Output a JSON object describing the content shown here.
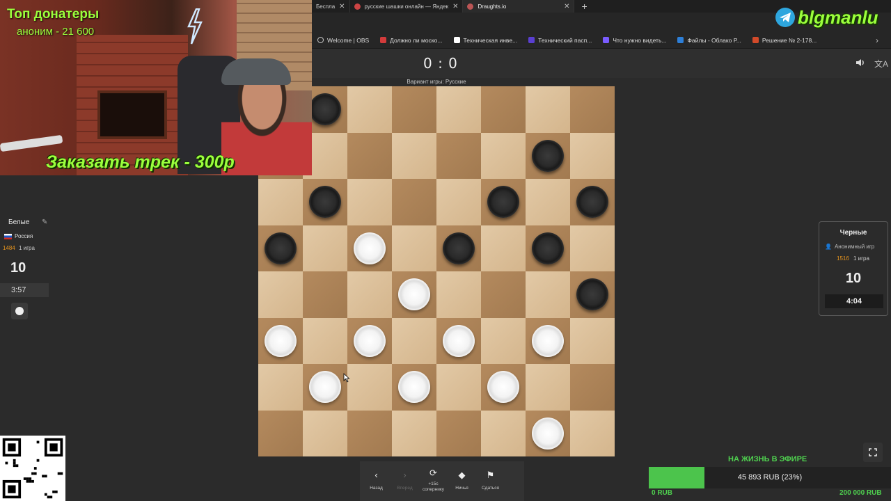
{
  "browser": {
    "tabs": [
      {
        "label": "Беспла",
        "active": false
      },
      {
        "label": "русские шашки онлайн — Яндек",
        "active": false
      },
      {
        "label": "Draughts.io",
        "active": true
      }
    ],
    "bookmarks": [
      {
        "label": "Welcome | OBS",
        "color": "#cccccc"
      },
      {
        "label": "Должно ли моско...",
        "color": "#d33b3b"
      },
      {
        "label": "Техническая инве...",
        "color": "#ffffff"
      },
      {
        "label": "Технический пасп...",
        "color": "#5a3fd1"
      },
      {
        "label": "Что нужно видеть...",
        "color": "#7a5cff"
      },
      {
        "label": "Файлы - Облако Р...",
        "color": "#2d7fd8"
      },
      {
        "label": "Решение № 2-178...",
        "color": "#d24a2a"
      }
    ]
  },
  "game": {
    "score": "0 : 0",
    "variant": "Вариант игры: Русские",
    "board": [
      [
        "",
        "b",
        "",
        "",
        "",
        "",
        "",
        ""
      ],
      [
        "",
        "",
        "",
        "",
        "",
        "",
        "b",
        ""
      ],
      [
        "",
        "b",
        "",
        "",
        "",
        "b",
        "",
        "b"
      ],
      [
        "b",
        "",
        "w",
        "",
        "b",
        "",
        "b",
        ""
      ],
      [
        "",
        "",
        "",
        "w",
        "",
        "",
        "",
        "b"
      ],
      [
        "w",
        "",
        "w",
        "",
        "w",
        "",
        "w",
        ""
      ],
      [
        "",
        "w",
        "",
        "w",
        "",
        "w",
        "",
        ""
      ],
      [
        "",
        "",
        "",
        "",
        "",
        "",
        "w",
        ""
      ]
    ]
  },
  "left_player": {
    "name": "Белые",
    "country": "Россия",
    "rating": "1484",
    "games": "1 игра",
    "pieces": "10",
    "clock": "3:57"
  },
  "right_player": {
    "name": "Черные",
    "anon": "Анонимный игр",
    "rating": "1516",
    "games": "1 игра",
    "pieces": "10",
    "clock": "4:04"
  },
  "toolbar": {
    "back": "Назад",
    "forward": "Вперед",
    "bonus_top": "+15с",
    "bonus": "сопернику",
    "draw": "Ничья",
    "resign": "Сдаться"
  },
  "stream": {
    "donors_title": "Топ донатеры",
    "donors_item": "аноним - 21 600",
    "order_track": "Заказать трек - 300р",
    "channel": "blgmanlu",
    "goal_title": "НА ЖИЗНЬ В ЭФИРЕ",
    "goal_text": "45 893 RUB (23%)",
    "goal_min": "0 RUB",
    "goal_max": "200 000 RUB",
    "goal_fraction": 0.23
  },
  "colors": {
    "accent_green": "#9bff3c",
    "rating_orange": "#e8951d"
  }
}
